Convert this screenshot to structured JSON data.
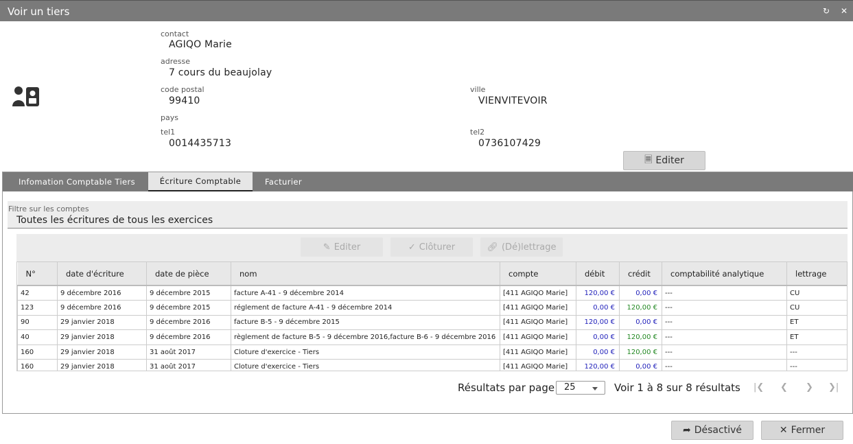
{
  "window": {
    "title": "Voir un tiers",
    "refresh_icon": "refresh-icon",
    "close_icon": "close-icon"
  },
  "contact": {
    "contact_label": "contact",
    "contact_value": "AGIQO Marie",
    "adresse_label": "adresse",
    "adresse_value": "7 cours du beaujolay",
    "cp_label": "code postal",
    "cp_value": "99410",
    "ville_label": "ville",
    "ville_value": "VIENVITEVOIR",
    "pays_label": "pays",
    "pays_value": "",
    "tel1_label": "tel1",
    "tel1_value": "0014435713",
    "tel2_label": "tel2",
    "tel2_value": "0736107429",
    "edit_label": "Editer"
  },
  "tabs": [
    {
      "label": "Infomation Comptable Tiers"
    },
    {
      "label": "Écriture Comptable"
    },
    {
      "label": "Facturier"
    }
  ],
  "filter": {
    "label": "Filtre sur les comptes",
    "value": "Toutes les écritures de tous les exercices"
  },
  "toolbar": {
    "edit_label": "Editer",
    "close_label": "Clôturer",
    "letter_label": "(Dé)lettrage"
  },
  "table": {
    "columns": [
      "N°",
      "date d'écriture",
      "date de pièce",
      "nom",
      "compte",
      "débit",
      "crédit",
      "comptabilité analytique",
      "lettrage"
    ],
    "rows": [
      [
        "42",
        "9 décembre 2016",
        "9 décembre 2015",
        "facture A-41 - 9 décembre 2014",
        "[411 AGIQO Marie]",
        "120,00 €",
        "0,00 €",
        "---",
        "CU"
      ],
      [
        "123",
        "9 décembre 2016",
        "9 décembre 2015",
        "réglement de facture A-41 - 9 décembre 2014",
        "[411 AGIQO Marie]",
        "0,00 €",
        "120,00 €",
        "---",
        "CU"
      ],
      [
        "90",
        "29 janvier 2018",
        "9 décembre 2016",
        "facture B-5 - 9 décembre 2015",
        "[411 AGIQO Marie]",
        "120,00 €",
        "0,00 €",
        "---",
        "ET"
      ],
      [
        "40",
        "29 janvier 2018",
        "9 décembre 2016",
        "règlement de facture B-5 - 9 décembre 2016,facture B-6 - 9 décembre 2016",
        "[411 AGIQO Marie]",
        "0,00 €",
        "120,00 €",
        "---",
        "ET"
      ],
      [
        "160",
        "29 janvier 2018",
        "31 août 2017",
        "Cloture d'exercice - Tiers",
        "[411 AGIQO Marie]",
        "0,00 €",
        "120,00 €",
        "---",
        "---"
      ],
      [
        "160",
        "29 janvier 2018",
        "31 août 2017",
        "Cloture d'exercice - Tiers",
        "[411 AGIQO Marie]",
        "120,00 €",
        "0,00 €",
        "---",
        "---"
      ]
    ]
  },
  "pager": {
    "per_page_label": "Résultats par page",
    "per_page_value": "25",
    "summary": "Voir 1 à 8 sur 8 résultats"
  },
  "footer": {
    "deactivate_label": "Désactivé",
    "close_label": "Fermer"
  },
  "colors": {
    "titlebar": "#7a7a7a",
    "debit": "#2222bb",
    "credit": "#228822"
  }
}
